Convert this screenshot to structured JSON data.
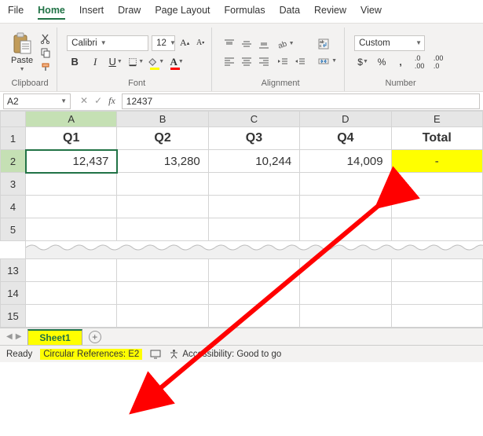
{
  "menu": [
    "File",
    "Home",
    "Insert",
    "Draw",
    "Page Layout",
    "Formulas",
    "Data",
    "Review",
    "View"
  ],
  "active_menu": "Home",
  "ribbon": {
    "clipboard": {
      "paste": "Paste",
      "label": "Clipboard"
    },
    "font": {
      "name": "Calibri",
      "size": "12",
      "label": "Font"
    },
    "alignment": {
      "label": "Alignment"
    },
    "number": {
      "format": "Custom",
      "label": "Number"
    }
  },
  "namebox": "A2",
  "formula": "12437",
  "columns": [
    "A",
    "B",
    "C",
    "D",
    "E"
  ],
  "rows_top": [
    "1",
    "2",
    "3",
    "4",
    "5"
  ],
  "rows_bottom": [
    "13",
    "14",
    "15"
  ],
  "headers": [
    "Q1",
    "Q2",
    "Q3",
    "Q4",
    "Total"
  ],
  "data": [
    "12,437",
    "13,280",
    "10,244",
    "14,009",
    "-"
  ],
  "selected": {
    "col": "A",
    "row": "2",
    "cell": "A2"
  },
  "sheet": "Sheet1",
  "status": {
    "ready": "Ready",
    "circular": "Circular References: E2",
    "accessibility": "Accessibility: Good to go"
  }
}
